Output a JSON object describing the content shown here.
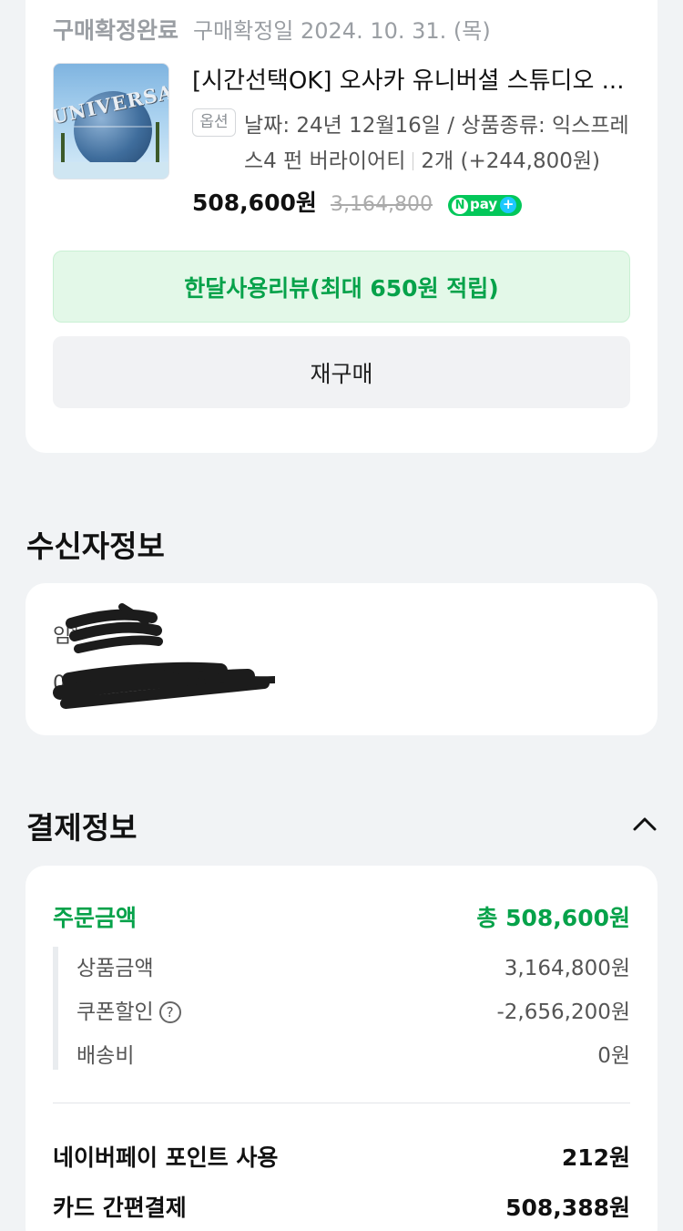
{
  "order": {
    "status": "구매확정완료",
    "confirm_date": "구매확정일 2024. 10. 31. (목)",
    "thumbnail_icon": "universal-globe-image",
    "thumbnail_text": "UNIVERSAL",
    "title": "[시간선택OK] 오사카 유니버셜 스튜디오 ...",
    "option_tag": "옵션",
    "option_line1": "날짜: 24년 12월16일 / 상품종류: 익스프레",
    "option_line2": "스4 펀 버라이어티",
    "quantity_info": "2개 (+244,800원)",
    "price": "508,600원",
    "original_price": "3,164,800",
    "npay_badge": "pay",
    "review_button": "한달사용리뷰(최대 650원 적립)",
    "rebuy_button": "재구매"
  },
  "recipient": {
    "section_title": "수신자정보",
    "name": "임**",
    "phone": "010-****-****"
  },
  "payment": {
    "section_title": "결제정보",
    "collapse_icon": "chevron-up-icon",
    "order_amount_label": "주문금액",
    "order_amount_value": "총 508,600원",
    "items": [
      {
        "label": "상품금액",
        "value": "3,164,800원"
      },
      {
        "label": "쿠폰할인",
        "value": "-2,656,200원"
      },
      {
        "label": "배송비",
        "value": "0원"
      }
    ],
    "naverpay_points_label": "네이버페이 포인트 사용",
    "naverpay_points_value": "212원",
    "card_payment_label": "카드 간편결제",
    "card_payment_value": "508,388원"
  },
  "colors": {
    "accent_green": "#06a24a",
    "npay_green": "#03c75a",
    "background": "#f1f3f5"
  }
}
